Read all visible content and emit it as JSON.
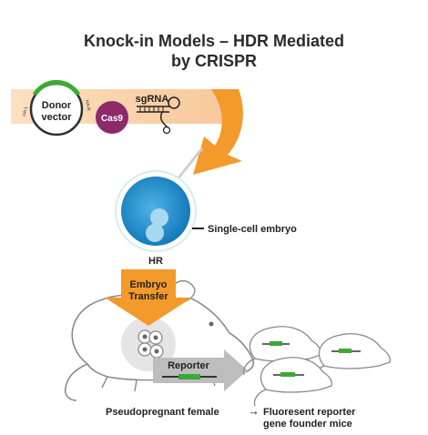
{
  "title_line1": "Knock-in Models – HDR Mediated",
  "title_line2": "by CRISPR",
  "donor_vector": {
    "line1": "Donor",
    "line2": "vector",
    "arm_left": "HA-L",
    "arm_right": "HA-R"
  },
  "cas9_label": "Cas9",
  "sgrna_label": "sgRNA",
  "embryo_label": "Single-cell embryo",
  "hr_label": "HR",
  "embryo_transfer": {
    "line1": "Embryo",
    "line2": "Transfer"
  },
  "reporter_label": "Reporter",
  "female_label": "Pseudopregnant female",
  "arrow_glyph": "→",
  "offspring": {
    "line1": "Fluoresent reporter",
    "line2": "gene founder mice"
  },
  "colors": {
    "orange": "#f39a2b",
    "peach": "#fbd5ae",
    "blue": "#1a8fcf",
    "purple": "#8e2a6a",
    "green": "#3aaa35",
    "gray_arrow": "#bdbdbd"
  }
}
